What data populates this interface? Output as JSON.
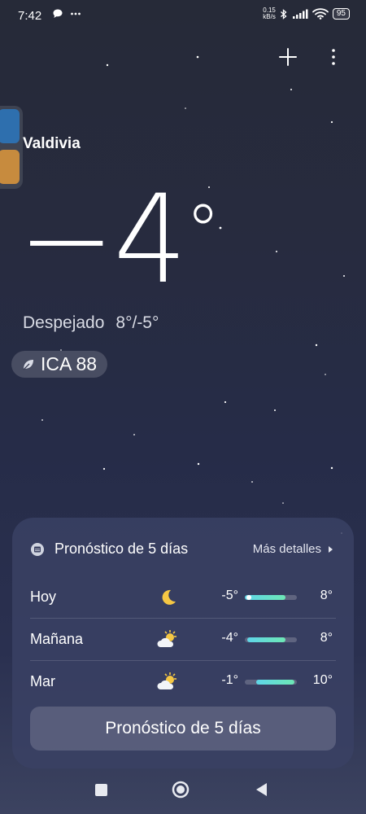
{
  "status_bar": {
    "time": "7:42",
    "speed_value": "0.15",
    "speed_unit": "kB/s",
    "battery": "95",
    "notification_icons": [
      "chat-icon",
      "more-dots-icon"
    ],
    "system_icons": [
      "bluetooth-icon",
      "signal-icon",
      "wifi-icon",
      "battery-icon"
    ]
  },
  "weather": {
    "city": "Valdivia",
    "temperature": "−4",
    "unit": "°",
    "condition": "Despejado",
    "range": "8°/-5°",
    "aqi_label": "ICA 88"
  },
  "forecast": {
    "title": "Pronóstico de 5 días",
    "more_label": "Más detalles",
    "days": [
      {
        "day": "Hoy",
        "icon": "moon-icon",
        "low": "-5°",
        "high": "8°",
        "bar_start": 0.0,
        "bar_end": 0.78,
        "dot": true
      },
      {
        "day": "Mañana",
        "icon": "partly-cloudy-icon",
        "low": "-4°",
        "high": "8°",
        "bar_start": 0.05,
        "bar_end": 0.78,
        "dot": false
      },
      {
        "day": "Mar",
        "icon": "partly-cloudy-icon",
        "low": "-1°",
        "high": "10°",
        "bar_start": 0.22,
        "bar_end": 0.95,
        "dot": false
      }
    ],
    "button_label": "Pronóstico de 5 días"
  },
  "colors": {
    "bar_start": "#5fd5e8",
    "bar_end": "#6de7b5",
    "sun": "#f5c744"
  }
}
